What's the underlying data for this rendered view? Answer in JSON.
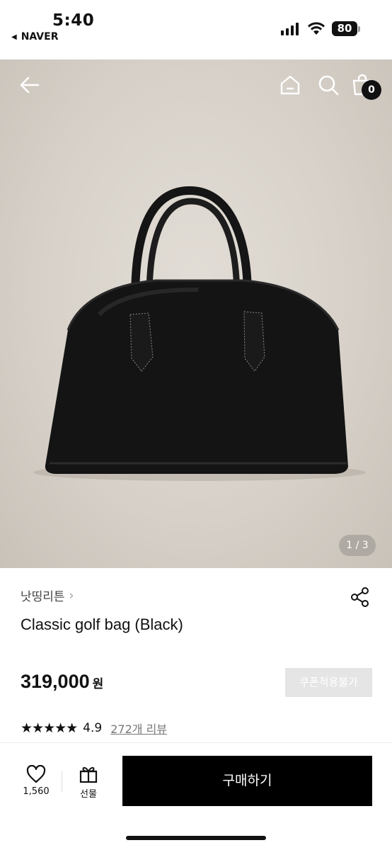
{
  "status_bar": {
    "time": "5:40",
    "back_app": "NAVER",
    "battery": "80"
  },
  "header": {
    "cart_count": "0"
  },
  "gallery": {
    "page_indicator": "1 / 3",
    "current_image": 1,
    "total_images": 3
  },
  "product": {
    "brand": "낫띵리튼",
    "title": "Classic golf bag (Black)",
    "price": "319,000",
    "price_unit": "원",
    "coupon_label": "쿠폰적용불가",
    "rating_stars": "★★★★★",
    "rating_score": "4.9",
    "review_link": "272개 리뷰"
  },
  "action_bar": {
    "like_count": "1,560",
    "gift_label": "선물",
    "buy_label": "구매하기"
  },
  "colors": {
    "primary_button": "#000000",
    "coupon_disabled": "#e5e5e5",
    "background": "#ffffff"
  }
}
